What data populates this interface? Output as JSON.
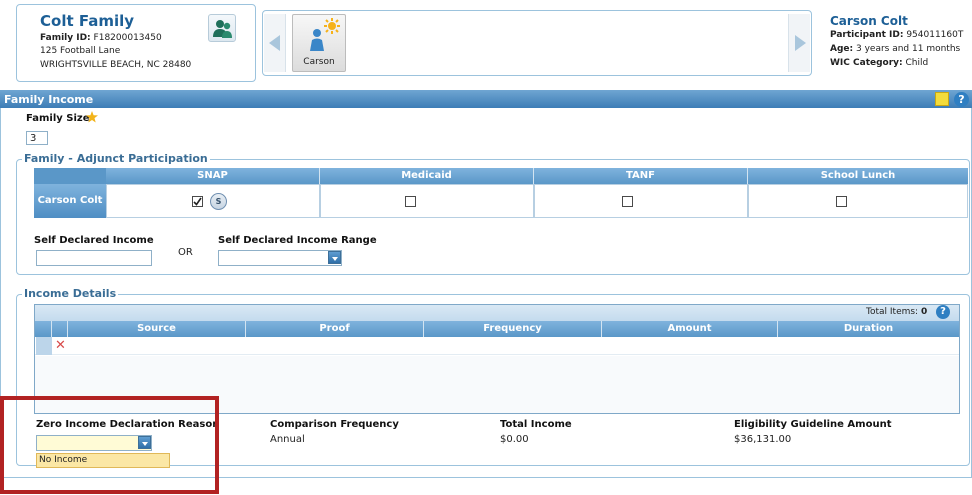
{
  "family": {
    "name": "Colt Family",
    "id_label": "Family ID:",
    "id_value": "F18200013450",
    "address1": "125 Football Lane",
    "address2": "WRIGHTSVILLE BEACH,   NC  28480"
  },
  "carousel": {
    "person_label": "Carson"
  },
  "participant": {
    "name": "Carson Colt",
    "id_label": "Participant ID:",
    "id_value": "954011160T",
    "age_label": "Age:",
    "age_value": "3 years and 11 months",
    "wic_label": "WIC Category:",
    "wic_value": "Child"
  },
  "panel": {
    "title": "Family Income"
  },
  "family_size": {
    "label": "Family Size",
    "value": "3"
  },
  "adjunct": {
    "legend": "Family - Adjunct Participation",
    "columns": [
      "SNAP",
      "Medicaid",
      "TANF",
      "School Lunch"
    ],
    "row_label": "Carson Colt",
    "snap_badge": "S"
  },
  "self_declared": {
    "income_label": "Self Declared Income",
    "or_label": "OR",
    "range_label": "Self Declared Income Range"
  },
  "income_details": {
    "legend": "Income Details",
    "total_items_label": "Total Items:",
    "total_items_value": "0",
    "columns": [
      "Source",
      "Proof",
      "Frequency",
      "Amount",
      "Duration"
    ]
  },
  "summary": {
    "zero_reason_label": "Zero Income Declaration Reason",
    "dropdown_option": "No Income",
    "comparison_label": "Comparison Frequency",
    "comparison_value": "Annual",
    "total_income_label": "Total Income",
    "total_income_value": "$0.00",
    "guideline_label": "Eligibility Guideline Amount",
    "guideline_value": "$36,131.00"
  },
  "colors": {
    "accent": "#1d5f96",
    "header_blue": "#5a97c8",
    "highlight_red": "#b22222"
  }
}
